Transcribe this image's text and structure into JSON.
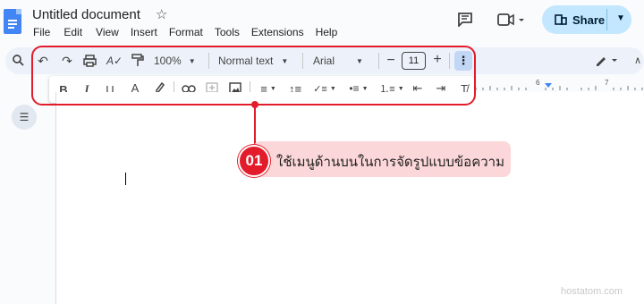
{
  "header": {
    "title": "Untitled document",
    "menu": [
      "File",
      "Edit",
      "View",
      "Insert",
      "Format",
      "Tools",
      "Extensions",
      "Help"
    ],
    "share_label": "Share"
  },
  "toolbar": {
    "zoom": "100%",
    "style": "Normal text",
    "font": "Arial",
    "font_size": "11"
  },
  "ruler": {
    "marks": [
      "6",
      "7"
    ]
  },
  "annotation": {
    "number": "01",
    "text": "ใช้เมนูด้านบนในการจัดรูปแบบข้อความ",
    "color": "#e21c2a",
    "bg": "#fcd7d9"
  },
  "watermark": "hostatom.com"
}
